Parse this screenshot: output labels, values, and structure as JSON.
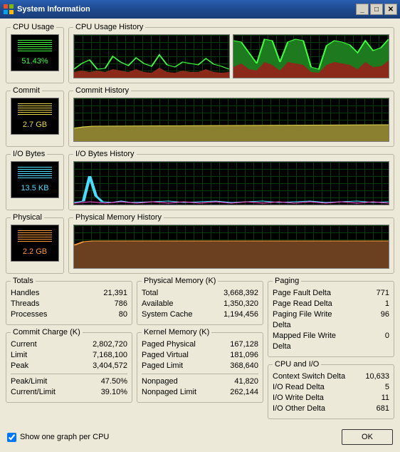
{
  "title": "System Information",
  "gauges": {
    "cpu": {
      "label": "CPU Usage",
      "hist_label": "CPU Usage History",
      "value": "51.43%"
    },
    "commit": {
      "label": "Commit",
      "hist_label": "Commit History",
      "value": "2.7 GB"
    },
    "io": {
      "label": "I/O Bytes",
      "hist_label": "I/O Bytes History",
      "value": "13.5 KB"
    },
    "phys": {
      "label": "Physical",
      "hist_label": "Physical Memory History",
      "value": "2.2 GB"
    }
  },
  "totals": {
    "legend": "Totals",
    "handles": {
      "label": "Handles",
      "value": "21,391"
    },
    "threads": {
      "label": "Threads",
      "value": "786"
    },
    "procs": {
      "label": "Processes",
      "value": "80"
    }
  },
  "commit_charge": {
    "legend": "Commit Charge (K)",
    "current": {
      "label": "Current",
      "value": "2,802,720"
    },
    "limit": {
      "label": "Limit",
      "value": "7,168,100"
    },
    "peak": {
      "label": "Peak",
      "value": "3,404,572"
    },
    "peak_limit": {
      "label": "Peak/Limit",
      "value": "47.50%"
    },
    "current_limit": {
      "label": "Current/Limit",
      "value": "39.10%"
    }
  },
  "physmem": {
    "legend": "Physical Memory (K)",
    "total": {
      "label": "Total",
      "value": "3,668,392"
    },
    "avail": {
      "label": "Available",
      "value": "1,350,320"
    },
    "cache": {
      "label": "System Cache",
      "value": "1,194,456"
    }
  },
  "kernel": {
    "legend": "Kernel Memory (K)",
    "paged_phys": {
      "label": "Paged Physical",
      "value": "167,128"
    },
    "paged_virt": {
      "label": "Paged Virtual",
      "value": "181,096"
    },
    "paged_lim": {
      "label": "Paged Limit",
      "value": "368,640"
    },
    "nonpaged": {
      "label": "Nonpaged",
      "value": "41,820"
    },
    "nonpaged_lim": {
      "label": "Nonpaged Limit",
      "value": "262,144"
    }
  },
  "paging": {
    "legend": "Paging",
    "fault": {
      "label": "Page Fault Delta",
      "value": "771"
    },
    "read": {
      "label": "Page Read Delta",
      "value": "1"
    },
    "write": {
      "label": "Paging File Write Delta",
      "value": "96"
    },
    "mapped": {
      "label": "Mapped File Write Delta",
      "value": "0"
    }
  },
  "cpuio": {
    "legend": "CPU and I/O",
    "ctx": {
      "label": "Context Switch Delta",
      "value": "10,633"
    },
    "read": {
      "label": "I/O Read Delta",
      "value": "5"
    },
    "write": {
      "label": "I/O Write Delta",
      "value": "11"
    },
    "other": {
      "label": "I/O Other Delta",
      "value": "681"
    }
  },
  "footer": {
    "checkbox": "Show one graph per CPU",
    "ok": "OK"
  },
  "chart_data": [
    {
      "type": "area",
      "title": "CPU Usage History (CPU 0)",
      "ylim": [
        0,
        100
      ],
      "values_pct": [
        20,
        38,
        42,
        20,
        22,
        55,
        40,
        30,
        50,
        35,
        28,
        60,
        30,
        25,
        40,
        35,
        30,
        48,
        32,
        28,
        25,
        30,
        40,
        35,
        30,
        55,
        30,
        25,
        20
      ]
    },
    {
      "type": "area",
      "title": "CPU Usage History (CPU 1)",
      "ylim": [
        0,
        100
      ],
      "values_pct": [
        90,
        85,
        60,
        35,
        95,
        90,
        40,
        85,
        92,
        88,
        90,
        80,
        30,
        25,
        75,
        90,
        85,
        78,
        60,
        88,
        65,
        70,
        92,
        88,
        90,
        85,
        80,
        75,
        95
      ]
    },
    {
      "type": "area",
      "title": "Commit History",
      "ylim": [
        0,
        100
      ],
      "values_pct": [
        32,
        34,
        35,
        35,
        36,
        36,
        36,
        36,
        37,
        37,
        37,
        37,
        38,
        38,
        38,
        38,
        38,
        38,
        38,
        38,
        39,
        39,
        39,
        39,
        39,
        39,
        39,
        39,
        39
      ]
    },
    {
      "type": "line",
      "title": "I/O Bytes History",
      "ylim": [
        0,
        100
      ],
      "values_pct": [
        5,
        8,
        55,
        15,
        6,
        5,
        7,
        5,
        6,
        8,
        5,
        7,
        6,
        5,
        8,
        5,
        6,
        7,
        5,
        6,
        5,
        8,
        5,
        6,
        7,
        5,
        6,
        5,
        7
      ]
    },
    {
      "type": "area",
      "title": "Physical Memory History",
      "ylim": [
        0,
        100
      ],
      "values_pct": [
        55,
        62,
        63,
        63,
        63,
        63,
        63,
        63,
        63,
        63,
        63,
        63,
        63,
        63,
        63,
        63,
        63,
        63,
        63,
        63,
        63,
        63,
        63,
        63,
        63,
        63,
        63,
        63,
        63
      ]
    }
  ]
}
